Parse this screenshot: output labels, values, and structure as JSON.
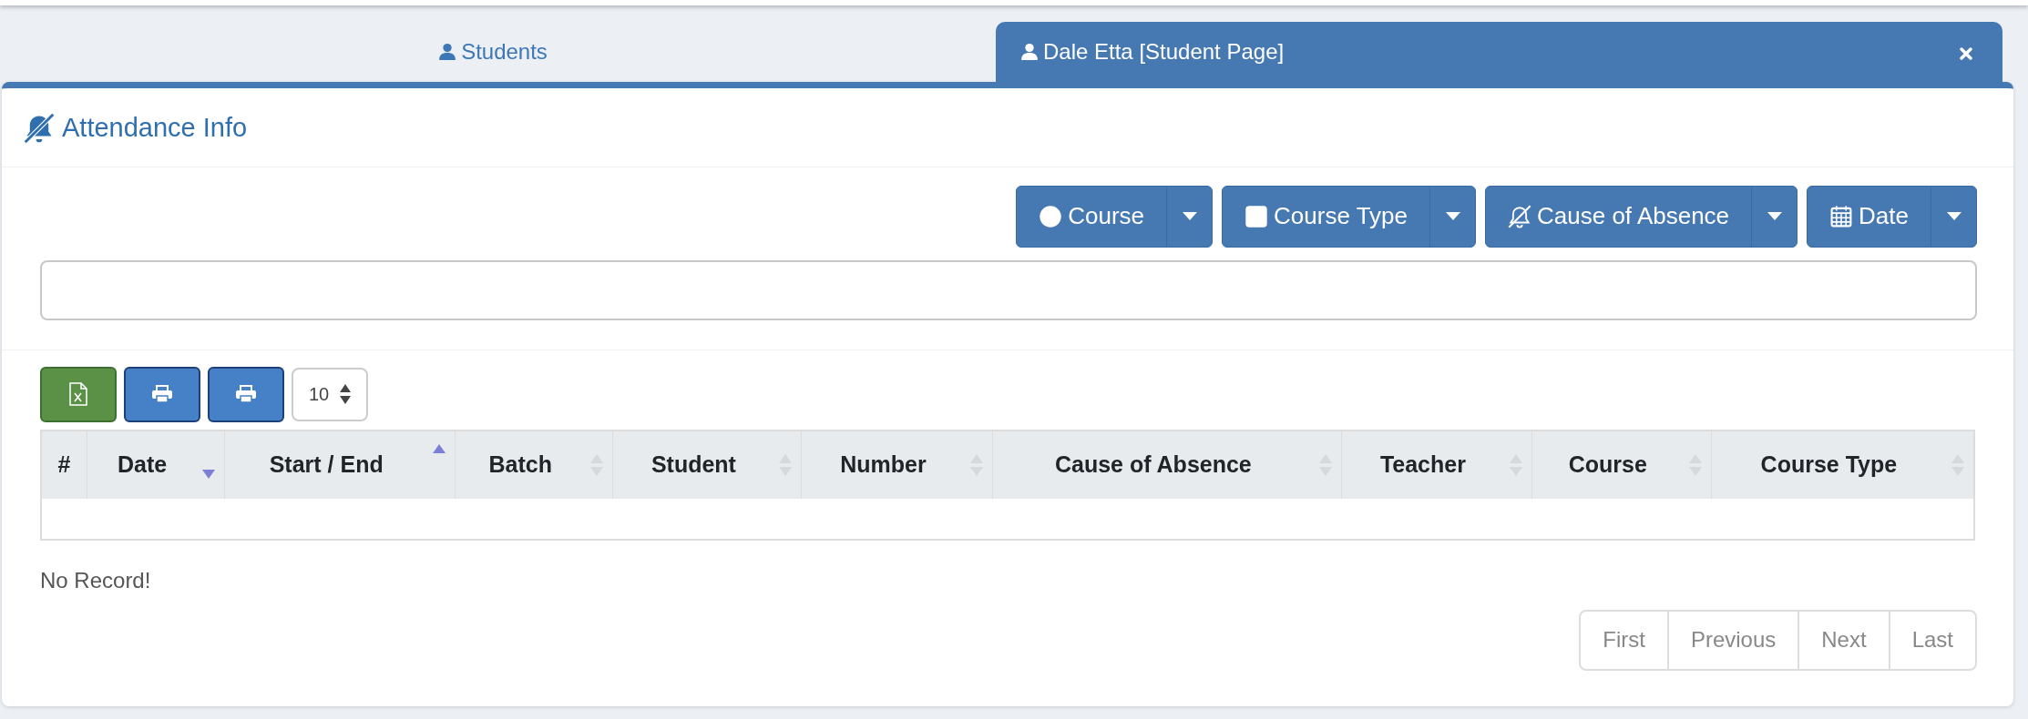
{
  "tabs": [
    {
      "label": "Students",
      "selected": false,
      "closable": false
    },
    {
      "label": "Dale Etta [Student Page]",
      "selected": true,
      "closable": true
    }
  ],
  "panel": {
    "title": "Attendance Info"
  },
  "filters": [
    {
      "label": "Course",
      "kind": "circle"
    },
    {
      "label": "Course Type",
      "kind": "square"
    },
    {
      "label": "Cause of Absence",
      "kind": "bell-slash"
    },
    {
      "label": "Date",
      "kind": "calendar"
    }
  ],
  "toolbar": {
    "buttons": [
      {
        "kind": "excel"
      },
      {
        "kind": "print"
      },
      {
        "kind": "print"
      }
    ],
    "page_size": "10"
  },
  "table": {
    "columns": [
      {
        "label": "#",
        "sortable": false,
        "sorted_asc": false,
        "sorted_desc": false
      },
      {
        "label": "Date",
        "sortable": true,
        "sorted_asc": false,
        "sorted_desc": true
      },
      {
        "label": "Start / End",
        "sortable": true,
        "sorted_asc": true,
        "sorted_desc": false
      },
      {
        "label": "Batch",
        "sortable": true,
        "sorted_asc": false,
        "sorted_desc": false
      },
      {
        "label": "Student",
        "sortable": true,
        "sorted_asc": false,
        "sorted_desc": false
      },
      {
        "label": "Number",
        "sortable": true,
        "sorted_asc": false,
        "sorted_desc": false
      },
      {
        "label": "Cause of Absence",
        "sortable": true,
        "sorted_asc": false,
        "sorted_desc": false
      },
      {
        "label": "Teacher",
        "sortable": true,
        "sorted_asc": false,
        "sorted_desc": false
      },
      {
        "label": "Course",
        "sortable": true,
        "sorted_asc": false,
        "sorted_desc": false
      },
      {
        "label": "Course Type",
        "sortable": true,
        "sorted_asc": false,
        "sorted_desc": false
      }
    ]
  },
  "empty_message": "No Record!",
  "pagination": [
    "First",
    "Previous",
    "Next",
    "Last"
  ]
}
